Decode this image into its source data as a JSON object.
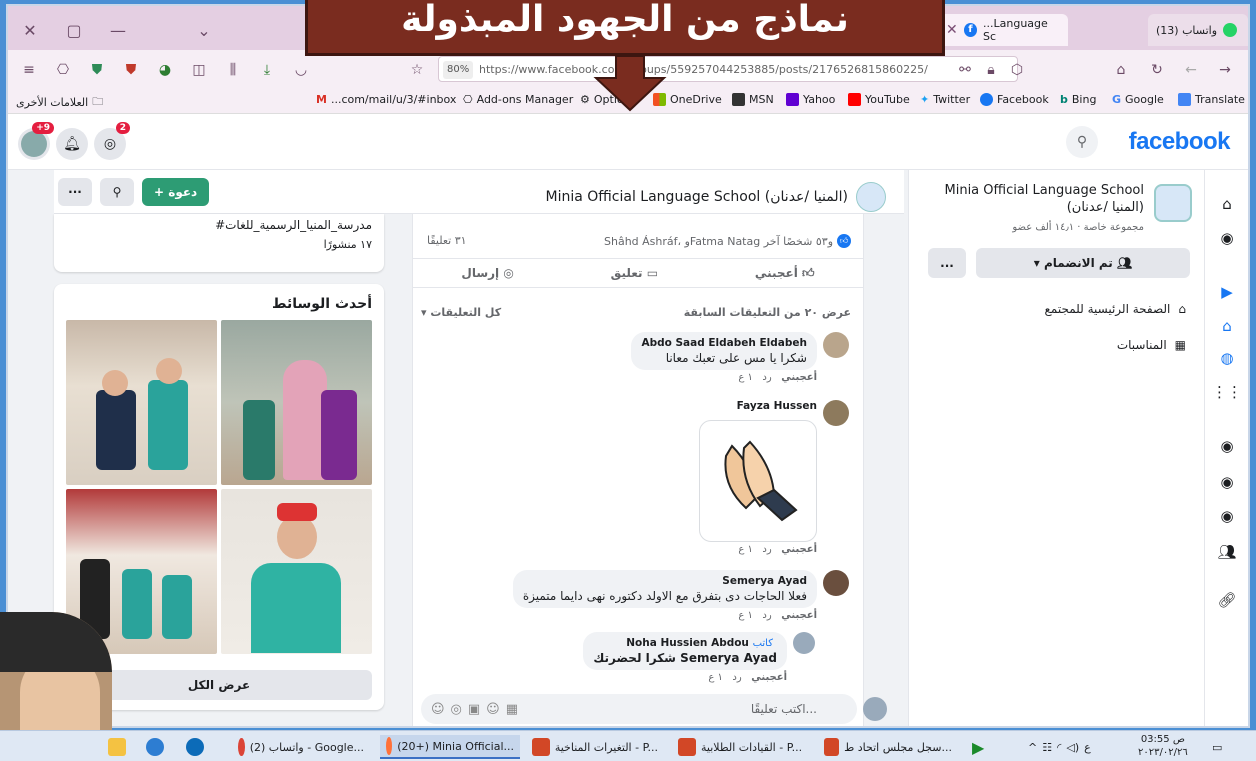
{
  "banner": {
    "text": "نماذج من الجهود المبذولة"
  },
  "browser": {
    "tab_whatsapp": "(13) واتساب",
    "tab_fb": "...Language Sc",
    "tab_fb_logo": "facebook-icon",
    "url": "https://www.facebook.com/groups/559257044253885/posts/2176526815860225/",
    "zoom": "80%"
  },
  "bookmarks": {
    "other": "العلامات الأخرى",
    "items": [
      "...com/mail/u/3/#inbox",
      "Add-ons Manager",
      "Options",
      "OneDrive",
      "MSN",
      "Yahoo",
      "YouTube",
      "Twitter",
      "Facebook",
      "Bing",
      "Google",
      "Translate"
    ]
  },
  "fb": {
    "logo": "facebook",
    "notif_badge": "+9",
    "msg_badge": "2"
  },
  "group": {
    "name_en": "Minia Official Language School",
    "name_ar": "(المنيا /عدنان)",
    "meta": "مجموعة خاصة · ١٤٫١ ألف عضو",
    "joined": "تم الانضمام",
    "more": "...",
    "home_link": "الصفحة الرئيسية للمجتمع",
    "events_link": "المناسبات",
    "header_title": "Minia Official Language School (المنيا /عدنان)",
    "invite": "+ دعوة"
  },
  "left": {
    "hashtag": "#مدرسة_المنيا_الرسمية_للغات",
    "posts": "١٧ منشورًا",
    "recent_media": "أحدث الوسائط",
    "see_all": "عرض الكل"
  },
  "post": {
    "reactors": "Shâhd Áshráf، وFatma Natag و٥٣ شخصًا آخر",
    "comments_count": "٣١ تعليقًا",
    "like": "أعجبني",
    "comment": "تعليق",
    "send": "إرسال",
    "view_prev": "عرض ٢٠ من التعليقات السابقة",
    "all_comments": "كل التعليقات"
  },
  "comments": [
    {
      "name": "Abdo Saad Eldabeh Eldabeh",
      "text": "شكرا يا مس على تعبك معانا",
      "time": "١ ع",
      "reply": "رد",
      "like": "أعجبني"
    },
    {
      "name": "Fayza Hussen",
      "text": "",
      "time": "١ ع",
      "reply": "رد",
      "like": "أعجبني"
    },
    {
      "name": "Semerya Ayad",
      "text": "فعلا الحاجات دى بتفرق مع الاولد دكتوره نهى دايما متميزة",
      "time": "١ ع",
      "reply": "رد",
      "like": "أعجبني"
    },
    {
      "name": "Noha Hussien Abdou",
      "author": "كاتب",
      "text": "شكرا لحضرتك Semerya Ayad",
      "time": "١ ع",
      "reply": "رد",
      "like": "أعجبني"
    }
  ],
  "comment_placeholder": "اكتب تعليقًا...",
  "taskbar": {
    "items": [
      "(2) واتساب - Google...",
      "(20+) Minia Official...",
      "التغيرات المناخية - P...",
      "القيادات الطلابية - P...",
      "سجل مجلس اتحاد ط..."
    ],
    "time": "03:55 ص",
    "date": "٢٠٢٣/٠٢/٢٦",
    "lang": "ع"
  }
}
